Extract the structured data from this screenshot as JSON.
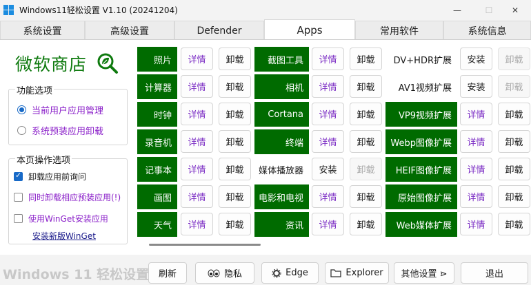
{
  "window": {
    "title": "Windows11轻松设置 V1.10  (20241204)",
    "minimize": "—",
    "maximize": "☐",
    "close": "✕"
  },
  "tabs": [
    {
      "label": "系统设置",
      "active": false
    },
    {
      "label": "高级设置",
      "active": false
    },
    {
      "label": "Defender",
      "active": false
    },
    {
      "label": "Apps",
      "active": true
    },
    {
      "label": "常用软件",
      "active": false
    },
    {
      "label": "系统信息",
      "active": false
    }
  ],
  "store": {
    "title": "微软商店",
    "icon": "magnifier-leaf-icon"
  },
  "function_group": {
    "label": "功能选项",
    "options": [
      {
        "label": "当前用户应用管理",
        "selected": true
      },
      {
        "label": "系统预装应用卸载",
        "selected": false
      }
    ]
  },
  "page_group": {
    "label": "本页操作选项",
    "checks": [
      {
        "label": "卸载应用前询问",
        "checked": true
      },
      {
        "label": "同时卸载相应预装应用(!)",
        "checked": false
      },
      {
        "label": "使用WinGet安装应用",
        "checked": false
      }
    ],
    "link": "安装新版WinGet"
  },
  "apps": {
    "col1": [
      {
        "name": "照片",
        "btn1": "详情",
        "btn2": "卸载"
      },
      {
        "name": "计算器",
        "btn1": "详情",
        "btn2": "卸载"
      },
      {
        "name": "时钟",
        "btn1": "详情",
        "btn2": "卸载"
      },
      {
        "name": "录音机",
        "btn1": "详情",
        "btn2": "卸载"
      },
      {
        "name": "记事本",
        "btn1": "详情",
        "btn2": "卸载"
      },
      {
        "name": "画图",
        "btn1": "详情",
        "btn2": "卸载"
      },
      {
        "name": "天气",
        "btn1": "详情",
        "btn2": "卸载"
      }
    ],
    "col2": [
      {
        "name": "截图工具",
        "btn1": "详情",
        "btn2": "卸载",
        "installed": true
      },
      {
        "name": "相机",
        "btn1": "详情",
        "btn2": "卸载",
        "installed": true
      },
      {
        "name": "Cortana",
        "btn1": "详情",
        "btn2": "卸载",
        "installed": true
      },
      {
        "name": "终端",
        "btn1": "详情",
        "btn2": "卸载",
        "installed": true
      },
      {
        "name": "媒体播放器",
        "btn1": "安装",
        "btn2": "卸载",
        "installed": false
      },
      {
        "name": "电影和电视",
        "btn1": "详情",
        "btn2": "卸载",
        "installed": true
      },
      {
        "name": "资讯",
        "btn1": "详情",
        "btn2": "卸载",
        "installed": true
      }
    ],
    "col3": [
      {
        "name": "DV+HDR扩展",
        "btn1": "安装",
        "btn2": "卸载",
        "installed": false
      },
      {
        "name": "AV1视频扩展",
        "btn1": "安装",
        "btn2": "卸载",
        "installed": false
      },
      {
        "name": "VP9视频扩展",
        "btn1": "详情",
        "btn2": "卸载",
        "installed": true
      },
      {
        "name": "Webp图像扩展",
        "btn1": "详情",
        "btn2": "卸载",
        "installed": true
      },
      {
        "name": "HEIF图像扩展",
        "btn1": "详情",
        "btn2": "卸载",
        "installed": true
      },
      {
        "name": "原始图像扩展",
        "btn1": "详情",
        "btn2": "卸载",
        "installed": true
      },
      {
        "name": "Web媒体扩展",
        "btn1": "详情",
        "btn2": "卸载",
        "installed": true
      }
    ]
  },
  "bottom": {
    "brand": "Windows 11 轻松设置",
    "refresh": "刷新",
    "privacy": "隐私",
    "edge": "Edge",
    "explorer": "Explorer",
    "other": "其他设置 ⋗",
    "exit": "退出"
  },
  "colors": {
    "green": "#006b00",
    "detail_purple": "#7a2bc4",
    "store_green": "#0e7a0e"
  }
}
